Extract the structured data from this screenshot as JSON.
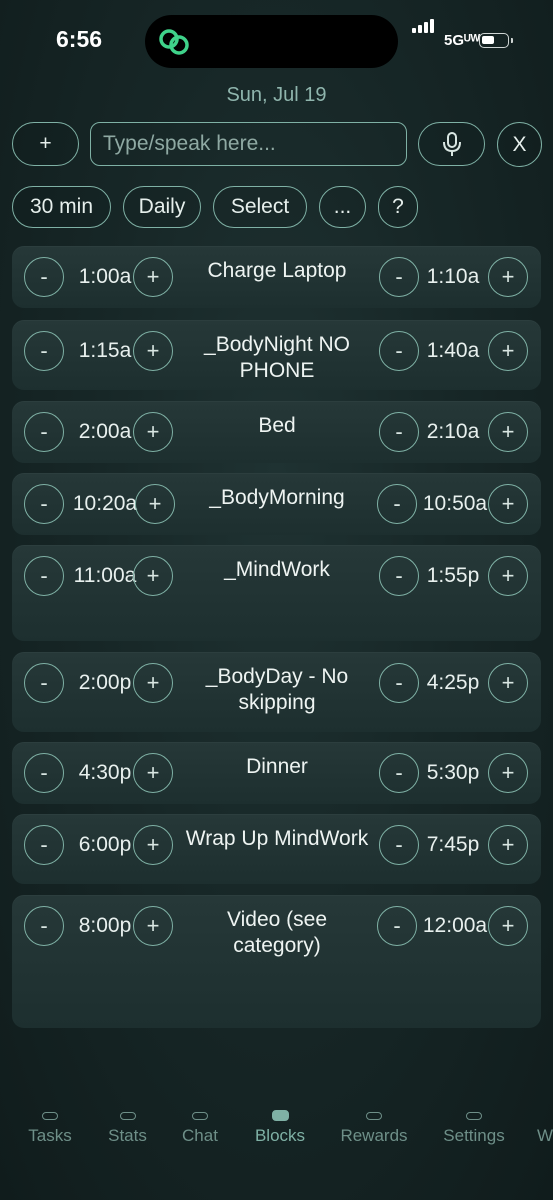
{
  "status_bar": {
    "time": "6:56",
    "network": "5Gᵁᵂ"
  },
  "header": {
    "date": "Sun, Jul 19"
  },
  "toolbar": {
    "add_label": "+",
    "input_placeholder": "Type/speak here...",
    "close_label": "X"
  },
  "filters": {
    "duration": "30 min",
    "frequency": "Daily",
    "select": "Select",
    "more": "...",
    "help": "?"
  },
  "controls": {
    "minus": "-",
    "plus": "+"
  },
  "blocks": [
    {
      "start": "1:00a",
      "title": "Charge Laptop",
      "end": "1:10a"
    },
    {
      "start": "1:15a",
      "title": "_BodyNight NO PHONE",
      "end": "1:40a"
    },
    {
      "start": "2:00a",
      "title": "Bed",
      "end": "2:10a"
    },
    {
      "start": "10:20a",
      "title": "_BodyMorning",
      "end": "10:50a"
    },
    {
      "start": "11:00a",
      "title": "_MindWork",
      "end": "1:55p"
    },
    {
      "start": "2:00p",
      "title": "_BodyDay - No skipping",
      "end": "4:25p"
    },
    {
      "start": "4:30p",
      "title": "Dinner",
      "end": "5:30p"
    },
    {
      "start": "6:00p",
      "title": "Wrap Up MindWork",
      "end": "7:45p"
    },
    {
      "start": "8:00p",
      "title": "Video (see category)",
      "end": "12:00a"
    }
  ],
  "tabs": [
    {
      "label": "Tasks"
    },
    {
      "label": "Stats"
    },
    {
      "label": "Chat"
    },
    {
      "label": "Blocks",
      "active": true
    },
    {
      "label": "Rewards"
    },
    {
      "label": "Settings"
    },
    {
      "label": "W"
    }
  ],
  "colors": {
    "accent": "#7fb1a5",
    "background": "#172727",
    "card": "#233535"
  }
}
